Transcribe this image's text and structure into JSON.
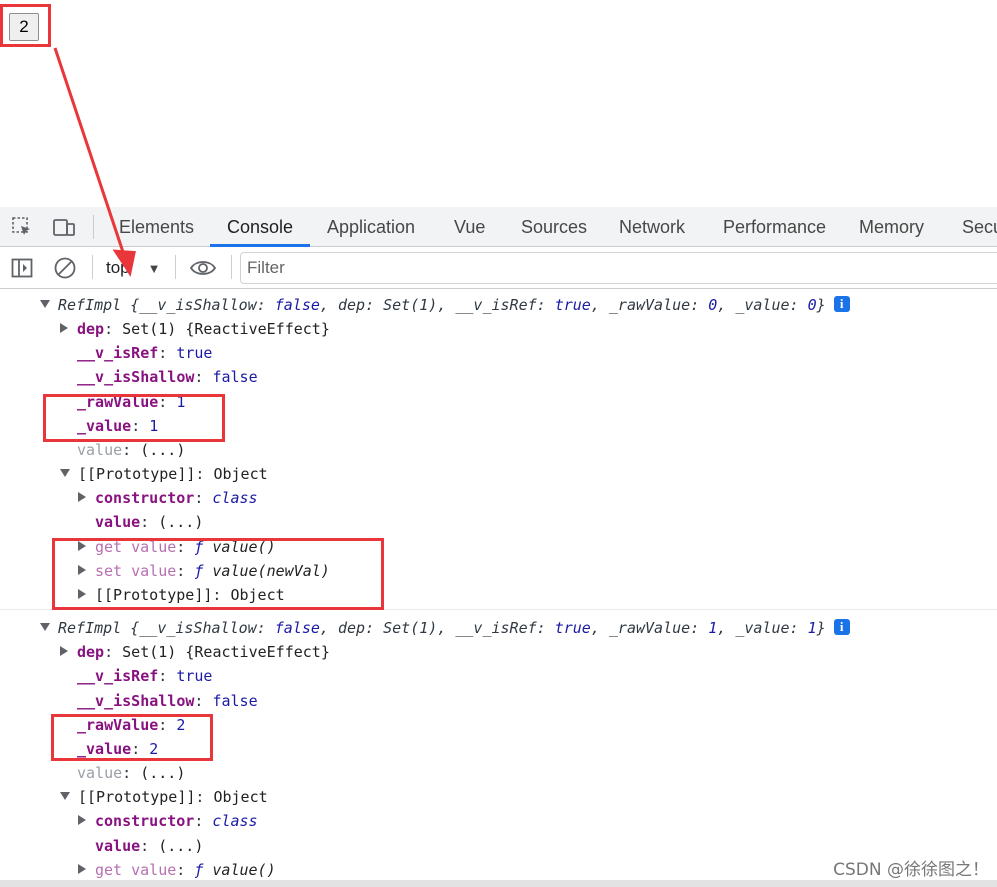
{
  "page": {
    "counter_button": "2"
  },
  "devtools": {
    "tabs": [
      "Elements",
      "Console",
      "Application",
      "Vue",
      "Sources",
      "Network",
      "Performance",
      "Memory",
      "Secu"
    ],
    "active_tab": "Console",
    "context": "top",
    "filter_placeholder": "Filter"
  },
  "console": {
    "log1": {
      "summary_class": "RefImpl",
      "summary_open": " {",
      "summary_props": [
        {
          "k": "__v_isShallow",
          "v": "false"
        },
        {
          "k": "dep",
          "v": "Set(1)"
        },
        {
          "k": "__v_isRef",
          "v": "true"
        },
        {
          "k": "_rawValue",
          "v": "0"
        },
        {
          "k": "_value",
          "v": "0"
        }
      ],
      "dep_key": "dep",
      "dep_val": "Set(1) {ReactiveEffect}",
      "isref_key": "__v_isRef",
      "isref_val": "true",
      "isshallow_key": "__v_isShallow",
      "isshallow_val": "false",
      "raw_key": "_rawValue",
      "raw_val": "1",
      "value_key": "_value",
      "value_val": "1",
      "getter_key": "value",
      "getter_val": "(...)",
      "proto_key": "[[Prototype]]",
      "proto_val": "Object",
      "ctor_key": "constructor",
      "ctor_val": "class",
      "proto_value_key": "value",
      "proto_value_val": "(...)",
      "get_key": "get value",
      "get_fn": "value()",
      "set_key": "set value",
      "set_fn": "value(newVal)",
      "proto2_key": "[[Prototype]]",
      "proto2_val": "Object"
    },
    "log2": {
      "summary_class": "RefImpl",
      "summary_open": " {",
      "summary_props": [
        {
          "k": "__v_isShallow",
          "v": "false"
        },
        {
          "k": "dep",
          "v": "Set(1)"
        },
        {
          "k": "__v_isRef",
          "v": "true"
        },
        {
          "k": "_rawValue",
          "v": "1"
        },
        {
          "k": "_value",
          "v": "1"
        }
      ],
      "dep_key": "dep",
      "dep_val": "Set(1) {ReactiveEffect}",
      "isref_key": "__v_isRef",
      "isref_val": "true",
      "isshallow_key": "__v_isShallow",
      "isshallow_val": "false",
      "raw_key": "_rawValue",
      "raw_val": "2",
      "value_key": "_value",
      "value_val": "2",
      "getter_key": "value",
      "getter_val": "(...)",
      "proto_key": "[[Prototype]]",
      "proto_val": "Object",
      "ctor_key": "constructor",
      "ctor_val": "class",
      "proto_value_key": "value",
      "proto_value_val": "(...)",
      "get_key": "get value",
      "get_fn": "value()"
    },
    "info_badge": "i"
  },
  "watermark": "CSDN @徐徐图之！",
  "colors": {
    "annotation_red": "#e8363a",
    "accent_blue": "#1a73e8"
  }
}
